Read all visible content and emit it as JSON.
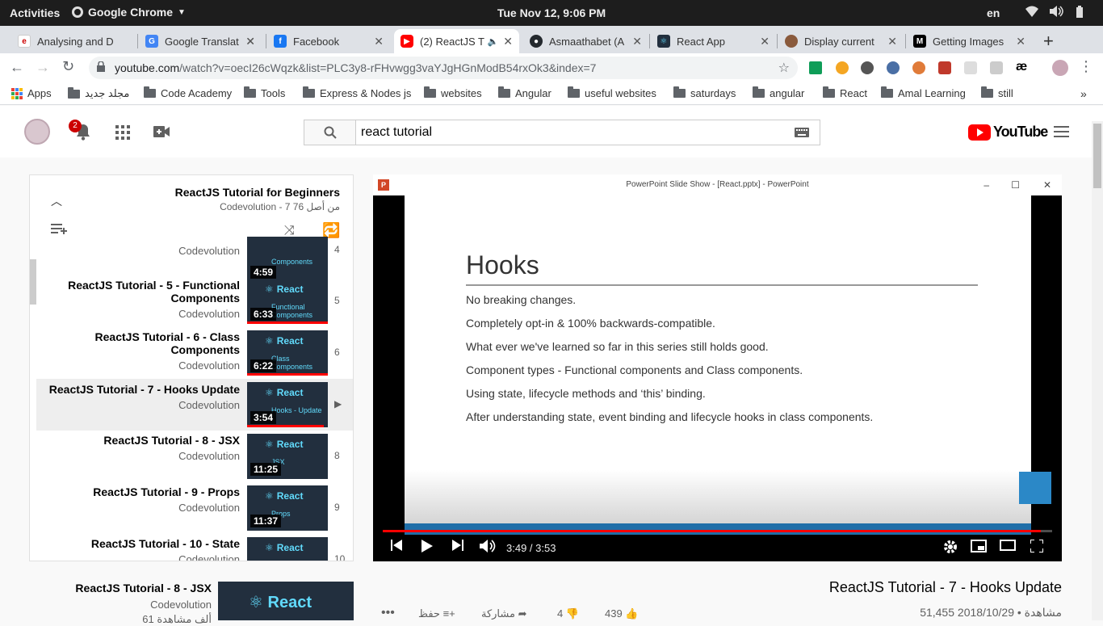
{
  "gnome": {
    "activities": "Activities",
    "app_name": "Google Chrome",
    "clock": "Tue Nov 12,  9:06 PM",
    "lang": "en"
  },
  "tabs": [
    {
      "title": "Analysing and D",
      "favicon": "edx-icon",
      "color": "#02262b"
    },
    {
      "title": "Google Translat",
      "favicon": "google-translate-icon",
      "color": "#4285f4"
    },
    {
      "title": "Facebook",
      "favicon": "facebook-icon",
      "color": "#1877f2"
    },
    {
      "title": "(2) ReactJS T",
      "favicon": "youtube-icon",
      "color": "#ff0000",
      "active": true
    },
    {
      "title": "Asmaathabet (A",
      "favicon": "github-icon",
      "color": "#24292e"
    },
    {
      "title": "React App",
      "favicon": "react-icon",
      "color": "#222f3e"
    },
    {
      "title": "Display current",
      "favicon": "user-avatar-icon",
      "color": "#8a5a3c"
    },
    {
      "title": "Getting Images",
      "favicon": "medium-icon",
      "color": "#000000"
    }
  ],
  "omnibox": {
    "domain": "youtube.com",
    "path": "/watch?v=oecI26cWqzk&list=PLC3y8-rFHvwgg3vaYJgHGnModB54rxOk3&index=7"
  },
  "bookmarks": {
    "apps": "Apps",
    "items": [
      "مجلد جديد",
      "Code Academy",
      "Tools",
      "Express & Nodes js",
      "websites",
      "Angular",
      "useful websites",
      "saturdays",
      "angular",
      "React",
      "Amal Learning",
      "still"
    ]
  },
  "youtube": {
    "notifications": "2",
    "search_value": "react tutorial",
    "logo_text": "YouTube"
  },
  "playlist": {
    "title": "ReactJS Tutorial for Beginners",
    "subtitle": "Codevolution - 7 من أصل 76",
    "items": [
      {
        "title": "",
        "channel": "Codevolution",
        "duration": "4:59",
        "index": "4",
        "sub": "Components",
        "progress": 1.0
      },
      {
        "title": "ReactJS Tutorial - 5 - Functional Components",
        "channel": "Codevolution",
        "duration": "6:33",
        "index": "5",
        "sub": "Functional Components",
        "progress": 1.0
      },
      {
        "title": "ReactJS Tutorial - 6 - Class Components",
        "channel": "Codevolution",
        "duration": "6:22",
        "index": "6",
        "sub": "Class Components",
        "progress": 1.0
      },
      {
        "title": "ReactJS Tutorial - 7 - Hooks Update",
        "channel": "Codevolution",
        "duration": "3:54",
        "index": "▶",
        "sub": "Hooks - Update",
        "progress": 0.95,
        "current": true
      },
      {
        "title": "ReactJS Tutorial - 8 - JSX",
        "channel": "Codevolution",
        "duration": "11:25",
        "index": "8",
        "sub": "JSX",
        "progress": 0.0
      },
      {
        "title": "ReactJS Tutorial - 9 - Props",
        "channel": "Codevolution",
        "duration": "11:37",
        "index": "9",
        "sub": "Props",
        "progress": 0.0
      },
      {
        "title": "ReactJS Tutorial - 10 - State",
        "channel": "Codevolution",
        "duration": "",
        "index": "10",
        "sub": "",
        "progress": 0.0
      }
    ]
  },
  "player": {
    "window_title": "PowerPoint Slide Show - [React.pptx] - PowerPoint",
    "slide_heading": "Hooks",
    "slide_bullets": [
      "No breaking changes.",
      "Completely opt-in & 100% backwards-compatible.",
      "What ever we've learned so far in this series still holds good.",
      "Component types - Functional components and Class components.",
      "Using state, lifecycle methods and ‘this’ binding.",
      "After understanding state, event binding and lifecycle hooks in class components."
    ],
    "time": "3:49 / 3:53",
    "progress": 0.983
  },
  "video": {
    "title": "ReactJS Tutorial - 7 - Hooks Update",
    "views_date": "51,455 مشاهدة • 2018/10/29",
    "likes": "439",
    "dislikes": "4",
    "share": "مشاركة",
    "save": "حفظ"
  },
  "suggested": {
    "title": "ReactJS Tutorial - 8 - JSX",
    "channel": "Codevolution",
    "views": "61 ألف مشاهدة",
    "thumb_text": "React"
  }
}
